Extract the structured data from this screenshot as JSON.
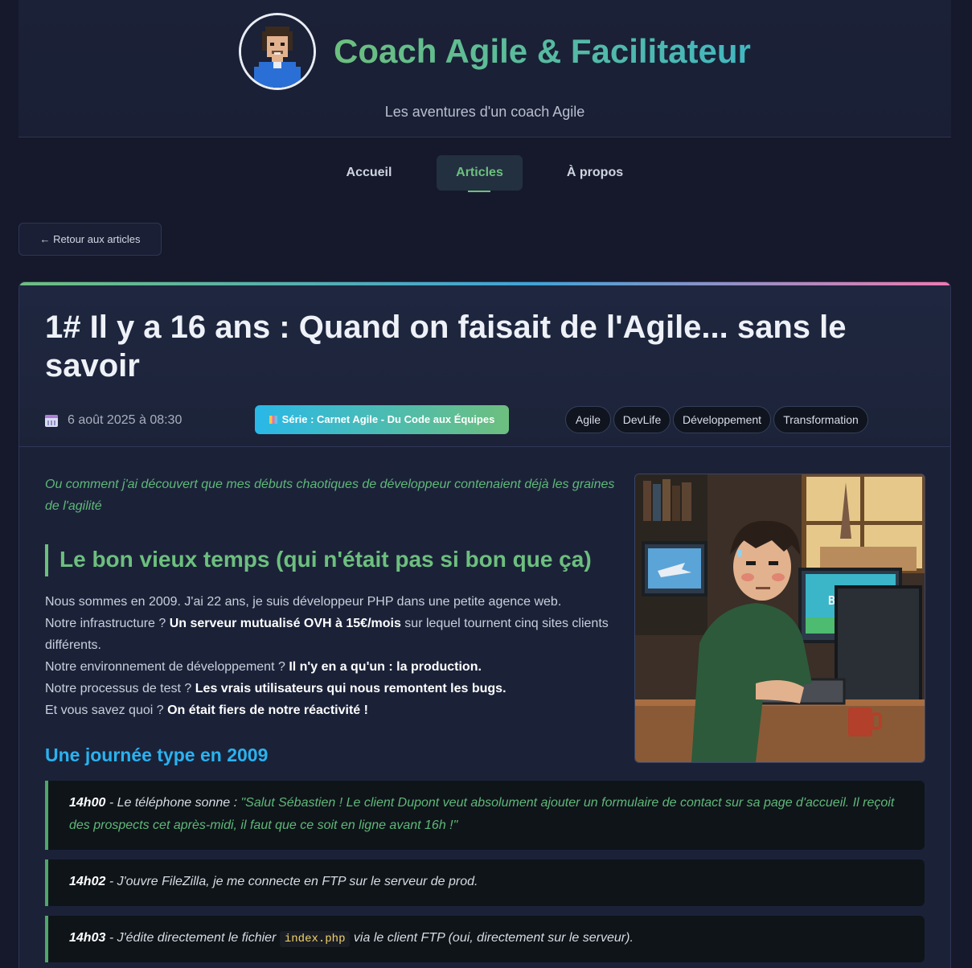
{
  "site": {
    "title": "Coach Agile & Facilitateur",
    "tagline": "Les aventures d'un coach Agile"
  },
  "nav": {
    "items": [
      {
        "label": "Accueil",
        "active": false
      },
      {
        "label": "Articles",
        "active": true
      },
      {
        "label": "À propos",
        "active": false
      }
    ]
  },
  "back_button": {
    "label": "← Retour aux articles"
  },
  "article": {
    "title": "1# Il y a 16 ans : Quand on faisait de l'Agile... sans le savoir",
    "date": "6 août 2025 à 08:30",
    "series": "Série : Carnet Agile - Du Code aux Équipes",
    "tags": [
      "Agile",
      "DevLife",
      "Développement",
      "Transformation"
    ],
    "intro": "Ou comment j'ai découvert que mes débuts chaotiques de développeur contenaient déjà les graines de l'agilité",
    "section_title": "Le bon vieux temps (qui n'était pas si bon que ça)",
    "paragraphs": {
      "p1": "Nous sommes en 2009. J'ai 22 ans, je suis développeur PHP dans une petite agence web.",
      "p2_pre": "Notre infrastructure ? ",
      "p2_bold": "Un serveur mutualisé OVH à 15€/mois",
      "p2_post": " sur lequel tournent cinq sites clients différents.",
      "p3_pre": "Notre environnement de développement ? ",
      "p3_bold": "Il n'y en a qu'un : la production.",
      "p4_pre": "Notre processus de test ? ",
      "p4_bold": "Les vrais utilisateurs qui nous remontent les bugs.",
      "p5_pre": "Et vous savez quoi ? ",
      "p5_bold": "On était fiers de notre réactivité !"
    },
    "subsection_title": "Une journée type en 2009",
    "illustration": {
      "screen_label": "BUG"
    },
    "timeline": [
      {
        "time": "14h00",
        "text": " - Le téléphone sonne : ",
        "quote": "\"Salut Sébastien ! Le client Dupont veut absolument ajouter un formulaire de contact sur sa page d'accueil. Il reçoit des prospects cet après-midi, il faut que ce soit en ligne avant 16h !\""
      },
      {
        "time": "14h02",
        "text": " - J'ouvre FileZilla, je me connecte en FTP sur le serveur de prod."
      },
      {
        "time": "14h03",
        "text_pre": " - J'édite directement le fichier ",
        "code": "index.php",
        "text_post": " via le client FTP (oui, directement sur le serveur)."
      }
    ]
  },
  "colors": {
    "background": "#16192b",
    "accent_green": "#6dbf7e",
    "accent_blue": "#2ab2f0",
    "accent_pink": "#f07ab0"
  }
}
